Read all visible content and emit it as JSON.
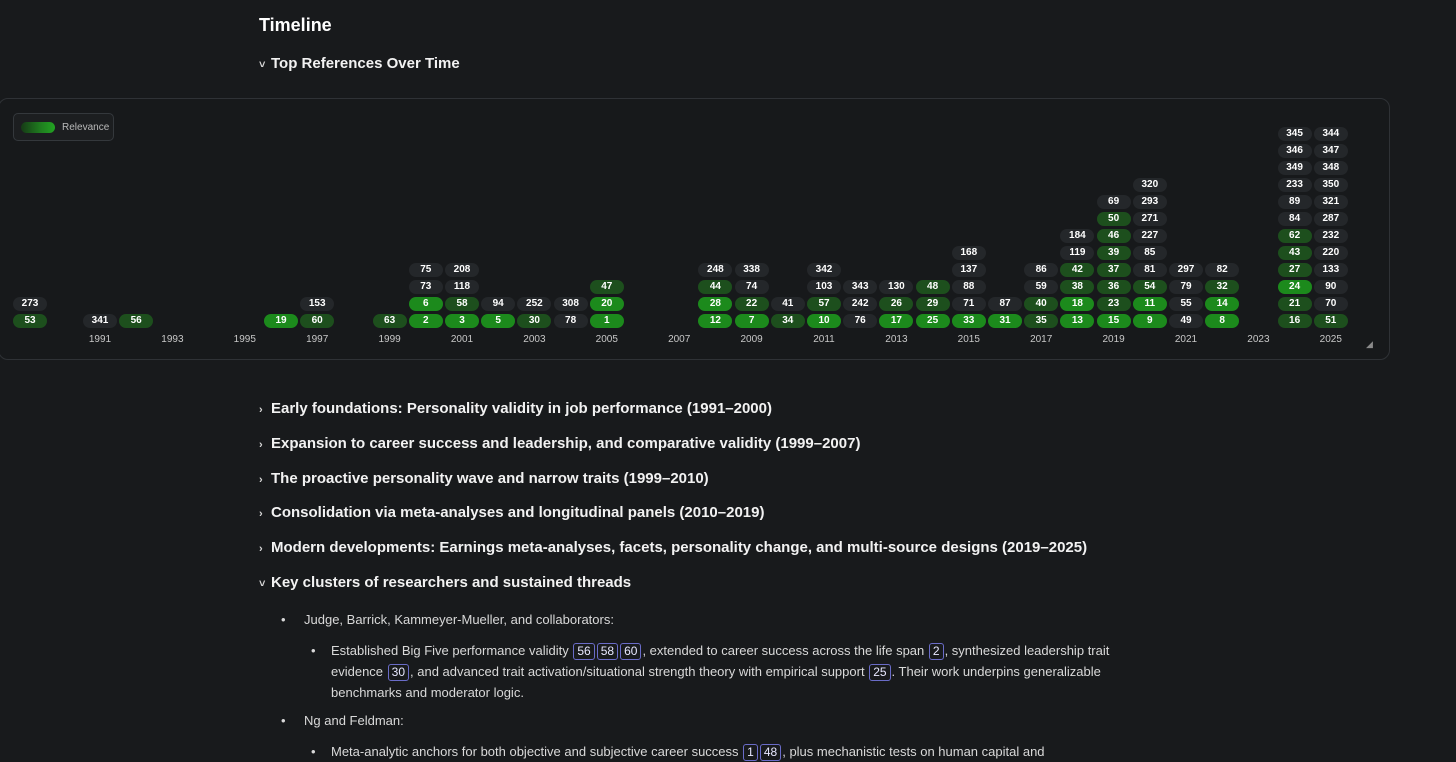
{
  "title": "Timeline",
  "top_refs_toggle": {
    "chevron": "˅",
    "label": "Top References Over Time"
  },
  "legend": {
    "label": "Relevance"
  },
  "colors": {
    "background": "#181a1c",
    "pill_dark": "#24272a",
    "pill_mid": "#1d4f1d",
    "pill_bright": "#1c8a1c",
    "ref_border": "#6a6cc8"
  },
  "chart_data": {
    "type": "table",
    "x_tick_labels": [
      "1991",
      "1993",
      "1995",
      "1997",
      "1999",
      "2001",
      "2003",
      "2005",
      "2007",
      "2009",
      "2011",
      "2013",
      "2015",
      "2017",
      "2019",
      "2021",
      "2023",
      "2025"
    ],
    "columns": [
      {
        "year": 1990,
        "refs": [
          53,
          273
        ],
        "tone": [
          "mid",
          "dark"
        ]
      },
      {
        "year": 1991,
        "refs": [
          341
        ],
        "tone": [
          "dark"
        ]
      },
      {
        "year": 1992,
        "refs": [
          56
        ],
        "tone": [
          "mid"
        ]
      },
      {
        "year": 1996,
        "refs": [
          19
        ],
        "tone": [
          "bright"
        ]
      },
      {
        "year": 1997,
        "refs": [
          60,
          153
        ],
        "tone": [
          "mid",
          "dark"
        ]
      },
      {
        "year": 1999,
        "refs": [
          63
        ],
        "tone": [
          "mid"
        ]
      },
      {
        "year": 2000,
        "refs": [
          2,
          6,
          73,
          75
        ],
        "tone": [
          "bright",
          "bright",
          "dark",
          "dark"
        ]
      },
      {
        "year": 2001,
        "refs": [
          3,
          58,
          118,
          208
        ],
        "tone": [
          "bright",
          "mid",
          "dark",
          "dark"
        ]
      },
      {
        "year": 2002,
        "refs": [
          5,
          94
        ],
        "tone": [
          "bright",
          "dark"
        ]
      },
      {
        "year": 2003,
        "refs": [
          30,
          252
        ],
        "tone": [
          "mid",
          "dark"
        ]
      },
      {
        "year": 2004,
        "refs": [
          78,
          308
        ],
        "tone": [
          "dark",
          "dark"
        ]
      },
      {
        "year": 2005,
        "refs": [
          1,
          20,
          47
        ],
        "tone": [
          "bright",
          "bright",
          "mid"
        ]
      },
      {
        "year": 2008,
        "refs": [
          12,
          28,
          44,
          248
        ],
        "tone": [
          "bright",
          "bright",
          "mid",
          "dark"
        ]
      },
      {
        "year": 2009,
        "refs": [
          7,
          22,
          74,
          338
        ],
        "tone": [
          "bright",
          "mid",
          "dark",
          "dark"
        ]
      },
      {
        "year": 2010,
        "refs": [
          34,
          41
        ],
        "tone": [
          "mid",
          "dark"
        ]
      },
      {
        "year": 2011,
        "refs": [
          10,
          57,
          103,
          342
        ],
        "tone": [
          "bright",
          "mid",
          "dark",
          "dark"
        ]
      },
      {
        "year": 2012,
        "refs": [
          76,
          242,
          343
        ],
        "tone": [
          "dark",
          "dark",
          "dark"
        ]
      },
      {
        "year": 2013,
        "refs": [
          17,
          26,
          130
        ],
        "tone": [
          "bright",
          "mid",
          "dark"
        ]
      },
      {
        "year": 2014,
        "refs": [
          25,
          29,
          48
        ],
        "tone": [
          "bright",
          "mid",
          "mid"
        ]
      },
      {
        "year": 2015,
        "refs": [
          33,
          71,
          88,
          137,
          168
        ],
        "tone": [
          "bright",
          "dark",
          "dark",
          "dark",
          "dark"
        ]
      },
      {
        "year": 2016,
        "refs": [
          31,
          87
        ],
        "tone": [
          "bright",
          "dark"
        ]
      },
      {
        "year": 2017,
        "refs": [
          35,
          40,
          59,
          86
        ],
        "tone": [
          "mid",
          "mid",
          "dark",
          "dark"
        ]
      },
      {
        "year": 2018,
        "refs": [
          13,
          18,
          38,
          42,
          119,
          184
        ],
        "tone": [
          "bright",
          "bright",
          "mid",
          "mid",
          "dark",
          "dark"
        ]
      },
      {
        "year": 2019,
        "refs": [
          15,
          23,
          36,
          37,
          39,
          46,
          50,
          69
        ],
        "tone": [
          "bright",
          "mid",
          "mid",
          "mid",
          "mid",
          "mid",
          "mid",
          "dark"
        ]
      },
      {
        "year": 2020,
        "refs": [
          9,
          11,
          54,
          81,
          85,
          227,
          271,
          293,
          320
        ],
        "tone": [
          "bright",
          "bright",
          "mid",
          "dark",
          "dark",
          "dark",
          "dark",
          "dark",
          "dark"
        ]
      },
      {
        "year": 2021,
        "refs": [
          49,
          55,
          79,
          297
        ],
        "tone": [
          "dark",
          "dark",
          "dark",
          "dark"
        ]
      },
      {
        "year": 2022,
        "refs": [
          8,
          14,
          32,
          82
        ],
        "tone": [
          "bright",
          "bright",
          "mid",
          "dark"
        ]
      },
      {
        "year": 2024,
        "refs": [
          16,
          21,
          24,
          27,
          43,
          62,
          84,
          89,
          233,
          349,
          346,
          345
        ],
        "tone": [
          "mid",
          "mid",
          "bright",
          "mid",
          "mid",
          "mid",
          "dark",
          "dark",
          "dark",
          "dark",
          "dark",
          "dark"
        ]
      },
      {
        "year": 2025,
        "refs": [
          51,
          70,
          90,
          133,
          220,
          232,
          287,
          321,
          350,
          348,
          347,
          344
        ],
        "tone": [
          "mid",
          "dark",
          "dark",
          "dark",
          "dark",
          "dark",
          "dark",
          "dark",
          "dark",
          "dark",
          "dark",
          "dark"
        ]
      }
    ]
  },
  "sections": [
    {
      "chevron": "›",
      "label": "Early foundations: Personality validity in job performance (1991–2000)"
    },
    {
      "chevron": "›",
      "label": "Expansion to career success and leadership, and comparative validity (1999–2007)"
    },
    {
      "chevron": "›",
      "label": "The proactive personality wave and narrow traits (1999–2010)"
    },
    {
      "chevron": "›",
      "label": "Consolidation via meta-analyses and longitudinal panels (2010–2019)"
    },
    {
      "chevron": "›",
      "label": "Modern developments: Earnings meta-analyses, facets, personality change, and multi-source designs (2019–2025)"
    },
    {
      "chevron": "˅",
      "label": "Key clusters of researchers and sustained threads"
    }
  ],
  "clusters": {
    "judge": {
      "name": "Judge, Barrick, Kammeyer-Mueller, and collaborators:",
      "detail": {
        "t1": "Established Big Five performance validity",
        "r1": "56",
        "r2": "58",
        "r3": "60",
        "t2": ", extended to career success across the life span",
        "r4": "2",
        "t3": ", synthesized leadership",
        "t4": "trait evidence",
        "r5": "30",
        "t5": ", and advanced trait activation/situational strength theory with empirical support",
        "r6": "25",
        "t6": ". Their work underpins",
        "t7": "generalizable benchmarks and moderator logic."
      }
    },
    "ng": {
      "name": "Ng and Feldman:",
      "detail": {
        "t1": "Meta-analytic anchors for both objective and subjective career success",
        "r1": "1",
        "r2": "48",
        "t2": ", plus mechanistic tests on human capital and"
      }
    }
  }
}
